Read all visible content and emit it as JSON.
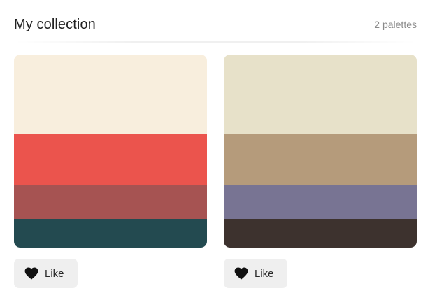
{
  "header": {
    "title": "My collection",
    "count": "2 palettes"
  },
  "palettes": [
    {
      "colors": [
        "#F8EEDD",
        "#EB544D",
        "#A65352",
        "#234A50"
      ],
      "like_label": "Like",
      "like_icon": "heart-icon"
    },
    {
      "colors": [
        "#E7E1C9",
        "#B59B7B",
        "#787493",
        "#3D322E"
      ],
      "like_label": "Like",
      "like_icon": "heart-icon"
    }
  ]
}
